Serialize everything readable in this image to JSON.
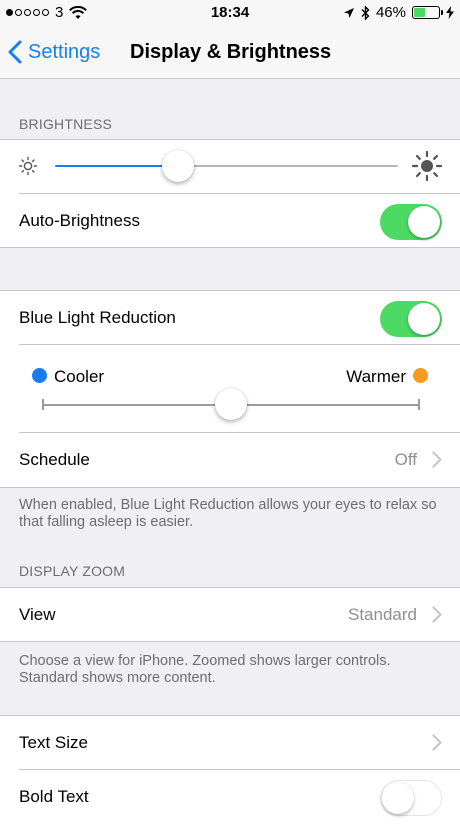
{
  "status_bar": {
    "carrier": "3",
    "time": "18:34",
    "battery_percent": "46%",
    "battery_level": 0.46,
    "signal_bars_filled": 1,
    "signal_bars_total": 5
  },
  "nav": {
    "back_label": "Settings",
    "title": "Display & Brightness"
  },
  "brightness": {
    "header": "BRIGHTNESS",
    "level": 0.36,
    "auto_brightness_label": "Auto-Brightness",
    "auto_brightness_on": true
  },
  "blue_light": {
    "label": "Blue Light Reduction",
    "enabled": true,
    "cooler_label": "Cooler",
    "warmer_label": "Warmer",
    "warmth_level": 0.5,
    "schedule_label": "Schedule",
    "schedule_value": "Off",
    "footer": "When enabled, Blue Light Reduction allows your eyes to relax so that falling asleep is easier."
  },
  "display_zoom": {
    "header": "DISPLAY ZOOM",
    "view_label": "View",
    "view_value": "Standard",
    "footer": "Choose a view for iPhone. Zoomed shows larger controls. Standard shows more content."
  },
  "text": {
    "text_size_label": "Text Size",
    "bold_text_label": "Bold Text",
    "bold_text_on": false
  },
  "colors": {
    "accent": "#157efb",
    "switch_on": "#4cd964",
    "cooler_dot": "#1a7cf0",
    "warmer_dot": "#f59a23",
    "secondary_text": "#8e8e93"
  }
}
